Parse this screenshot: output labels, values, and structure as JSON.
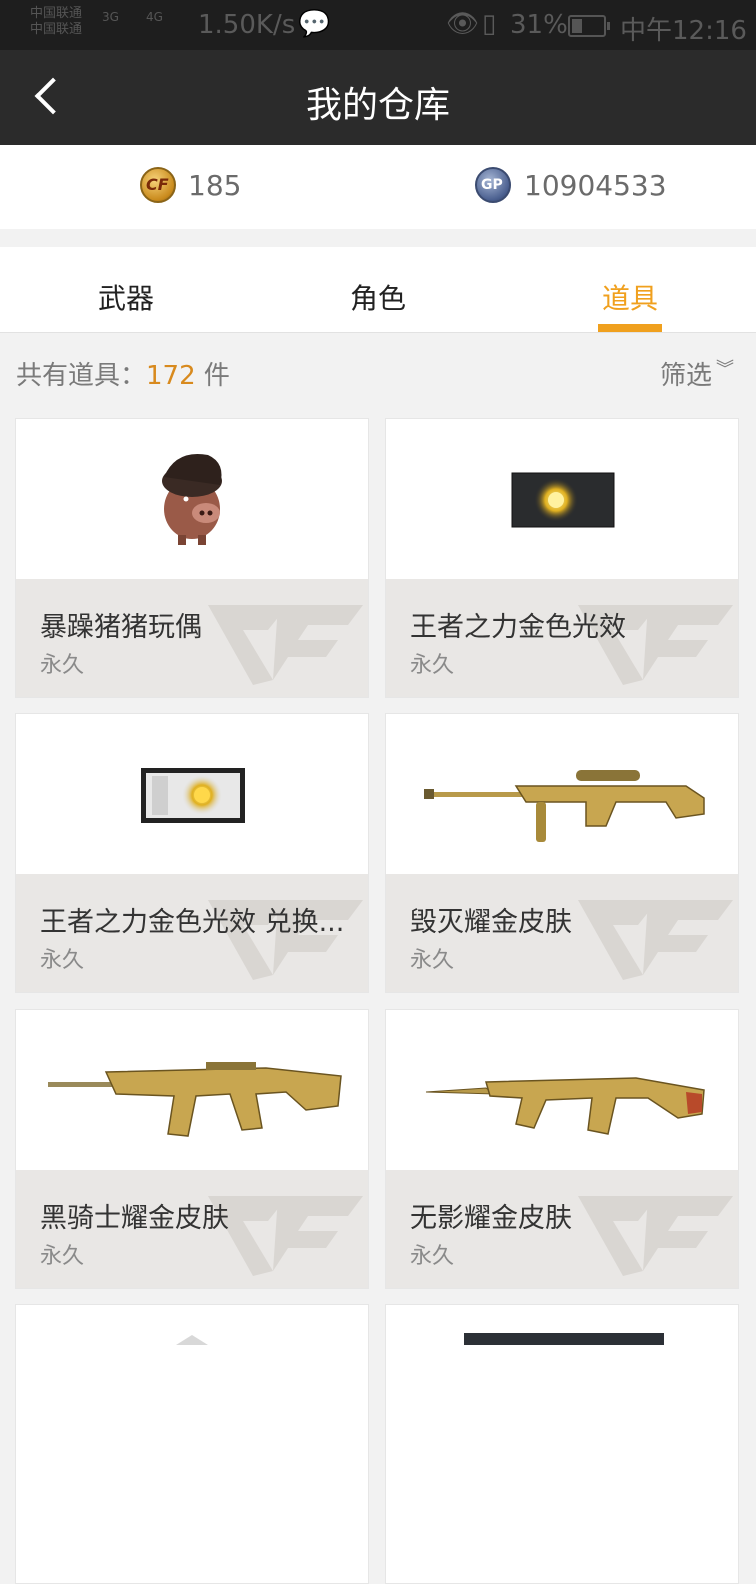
{
  "status_bar": {
    "carrier_1": "中国联通",
    "carrier_2": "中国联通",
    "signal_1": "3G",
    "signal_2": "4G",
    "net_speed": "1.50K/s",
    "battery": "31%",
    "time": "中午12:16"
  },
  "header": {
    "title": "我的仓库"
  },
  "currency": {
    "cf_points": "185",
    "gp_points": "10904533"
  },
  "tabs": [
    {
      "label": "武器"
    },
    {
      "label": "角色"
    },
    {
      "label": "道具"
    }
  ],
  "summary": {
    "prefix": "共有道具：",
    "count": "172",
    "suffix": " 件"
  },
  "filter": {
    "label": "筛选"
  },
  "items": [
    {
      "name": "暴躁猪猪玩偶",
      "duration": "永久",
      "icon": "pig-doll-icon"
    },
    {
      "name": "王者之力金色光效",
      "duration": "永久",
      "icon": "gold-effect-icon"
    },
    {
      "name": "王者之力金色光效 兑换...",
      "duration": "永久",
      "icon": "gold-effect-ticket-icon"
    },
    {
      "name": "毁灭耀金皮肤",
      "duration": "永久",
      "icon": "sniper-rifle-icon"
    },
    {
      "name": "黑骑士耀金皮肤",
      "duration": "永久",
      "icon": "assault-rifle-icon"
    },
    {
      "name": "无影耀金皮肤",
      "duration": "永久",
      "icon": "ak-rifle-icon"
    }
  ],
  "colors": {
    "accent": "#f0a01e",
    "header_bg": "#2b2b2b",
    "card_info_bg": "#e9e7e5"
  }
}
